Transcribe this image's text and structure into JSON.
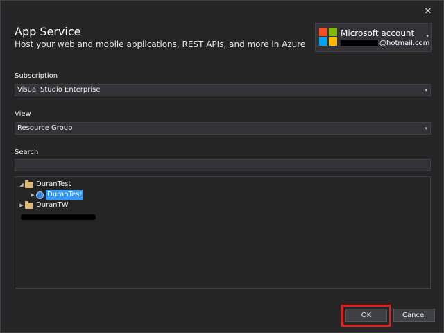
{
  "dialog": {
    "close_glyph": "✕",
    "title": "App Service",
    "subtitle": "Host your web and mobile applications, REST APIs, and more in Azure"
  },
  "account": {
    "icon": "microsoft-logo",
    "name": "Microsoft account",
    "email_suffix": "@hotmail.com",
    "caret": "▾",
    "logo_colors": [
      "#f25022",
      "#7fba00",
      "#00a4ef",
      "#ffb900"
    ]
  },
  "subscription": {
    "label": "Subscription",
    "value": "Visual Studio Enterprise",
    "caret": "▾"
  },
  "view": {
    "label": "View",
    "value": "Resource Group",
    "caret": "▾"
  },
  "search": {
    "label": "Search",
    "value": ""
  },
  "tree": {
    "items": [
      {
        "label": "DuranTest",
        "expander": "◢",
        "icon": "folder-icon"
      },
      {
        "label": "DuranTest",
        "expander": "▶",
        "icon": "app-service-icon",
        "selected": true
      },
      {
        "label": "DuranTW",
        "expander": "▶",
        "icon": "folder-icon"
      }
    ]
  },
  "buttons": {
    "ok": "OK",
    "cancel": "Cancel"
  },
  "colors": {
    "background": "#252526",
    "selection": "#3399ff",
    "highlight": "#e02020"
  }
}
